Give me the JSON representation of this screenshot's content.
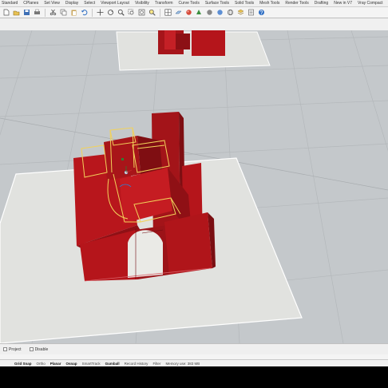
{
  "menu_tabs": [
    "Standard",
    "CPlanes",
    "Set View",
    "Display",
    "Select",
    "Viewport Layout",
    "Visibility",
    "Transform",
    "Curve Tools",
    "Surface Tools",
    "Solid Tools",
    "Mesh Tools",
    "Render Tools",
    "Drafting",
    "New in V7",
    "Vray Compact"
  ],
  "toolbar_icons": [
    "new-file-icon",
    "open-icon",
    "save-icon",
    "print-icon",
    "cut-icon",
    "copy-icon",
    "paste-icon",
    "undo-icon",
    "pan-icon",
    "rotate-view-icon",
    "zoom-icon",
    "zoom-window-icon",
    "zoom-extents-icon",
    "zoom-selected-icon",
    "four-views-icon",
    "cplane-icon",
    "material-icon",
    "render-icon",
    "display-mode-icon",
    "shade-icon",
    "wireframe-icon",
    "layer-icon",
    "properties-icon",
    "help-icon"
  ],
  "osnap": {
    "project_label": "Project",
    "disable_label": "Disable"
  },
  "status": {
    "panes": [
      {
        "label": "Grid Snap",
        "active": true
      },
      {
        "label": "Ortho",
        "active": false
      },
      {
        "label": "Planar",
        "active": true
      },
      {
        "label": "Osnap",
        "active": true
      },
      {
        "label": "SmartTrack",
        "active": false
      },
      {
        "label": "Gumball",
        "active": true
      },
      {
        "label": "Record History",
        "active": false
      },
      {
        "label": "Filter",
        "active": false
      }
    ],
    "memory": "Memory use: 383 MB"
  },
  "colors": {
    "viewport_bg": "#c4c8cb",
    "model_red": "#b5151b",
    "selection_yellow": "#f2d25a",
    "plane_fill": "#e1e2df"
  }
}
